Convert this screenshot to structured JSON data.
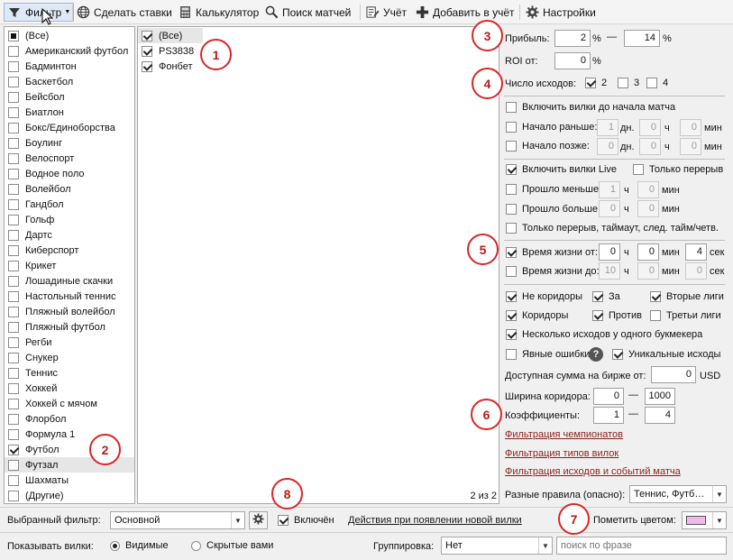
{
  "toolbar": {
    "filter": "Фильтр",
    "place_bets": "Сделать ставки",
    "calculator": "Калькулятор",
    "match_search": "Поиск матчей",
    "accounting": "Учёт",
    "add_to_accounting": "Добавить в учёт",
    "settings": "Настройки"
  },
  "sports": {
    "items": [
      "(Все)",
      "Американский футбол",
      "Бадминтон",
      "Баскетбол",
      "Бейсбол",
      "Биатлон",
      "Бокс/Единоборства",
      "Боулинг",
      "Велоспорт",
      "Водное поло",
      "Волейбол",
      "Гандбол",
      "Гольф",
      "Дартс",
      "Киберспорт",
      "Крикет",
      "Лошадиные скачки",
      "Настольный теннис",
      "Пляжный волейбол",
      "Пляжный футбол",
      "Регби",
      "Снукер",
      "Теннис",
      "Хоккей",
      "Хоккей с мячом",
      "Флорбол",
      "Формула 1",
      "Футбол",
      "Футзал",
      "Шахматы",
      "(Другие)"
    ],
    "checked": [
      27
    ],
    "selected": 28
  },
  "bookmakers": {
    "items": [
      "(Все)",
      "PS3838",
      "Фонбет"
    ],
    "checked": [
      0,
      1,
      2
    ],
    "count_label": "2 из 2"
  },
  "settings": {
    "profit_label": "Прибыль:",
    "profit_from": "2",
    "profit_to": "14",
    "percent": "%",
    "dash": "—",
    "roi_label": "ROI от:",
    "roi_value": "0",
    "outcomes_label": "Число исходов:",
    "outcome_2": "2",
    "outcome_3": "3",
    "outcome_4": "4",
    "prematch_label": "Включить вилки до начала матча",
    "start_earlier": "Начало раньше:",
    "start_later": "Начало позже:",
    "days": "дн.",
    "hours": "ч",
    "minutes": "мин",
    "seconds": "сек",
    "earlier_d": "1",
    "earlier_h": "0",
    "earlier_m": "0",
    "later_d": "0",
    "later_h": "0",
    "later_m": "0",
    "live_label": "Включить вилки Live",
    "only_break": "Только перерыв",
    "elapsed_less": "Прошло меньше:",
    "elapsed_more": "Прошло больше:",
    "less_h": "1",
    "less_m": "0",
    "more_h": "0",
    "more_m": "0",
    "only_break_long": "Только перерыв, таймаут, след. тайм/четв.",
    "lifetime_from": "Время жизни от:",
    "lifetime_to": "Время жизни до:",
    "lf_h": "0",
    "lf_m": "0",
    "lf_s": "4",
    "lt_h": "10",
    "lt_m": "0",
    "lt_s": "0",
    "not_corridors": "Не коридоры",
    "for": "За",
    "second_leagues": "Вторые лиги",
    "corridors": "Коридоры",
    "against": "Против",
    "third_leagues": "Третьи лиги",
    "multi_outcomes": "Несколько исходов у одного букмекера",
    "obvious_errors": "Явные ошибки",
    "help": "?",
    "unique_outcomes": "Уникальные исходы",
    "exchange_sum": "Доступная сумма на бирже от:",
    "exchange_value": "0",
    "usd": "USD",
    "corridor_width": "Ширина коридора:",
    "cw_from": "0",
    "cw_to": "1000",
    "coefficients": "Коэффициенты:",
    "coef_from": "1",
    "coef_to": "4",
    "filter_champs": "Фильтрация чемпионатов",
    "filter_types": "Фильтрация типов вилок",
    "filter_outcomes": "Фильтрация исходов и событий матча",
    "diff_rules": "Разные правила (опасно):",
    "diff_rules_value": "Теннис, Футб…"
  },
  "bottom": {
    "selected_filter": "Выбранный фильтр:",
    "filter_value": "Основной",
    "enabled": "Включён",
    "actions_link": "Действия при появлении новой вилки",
    "mark_color": "Пометить цветом:",
    "mark_color_hex": "#f4b8e8",
    "show_label": "Показывать вилки:",
    "visible": "Видимые",
    "hidden": "Скрытые вами",
    "grouping": "Группировка:",
    "grouping_value": "Нет",
    "search_placeholder": "поиск по фразе"
  },
  "badges": [
    "1",
    "2",
    "3",
    "4",
    "5",
    "6",
    "7",
    "8"
  ]
}
